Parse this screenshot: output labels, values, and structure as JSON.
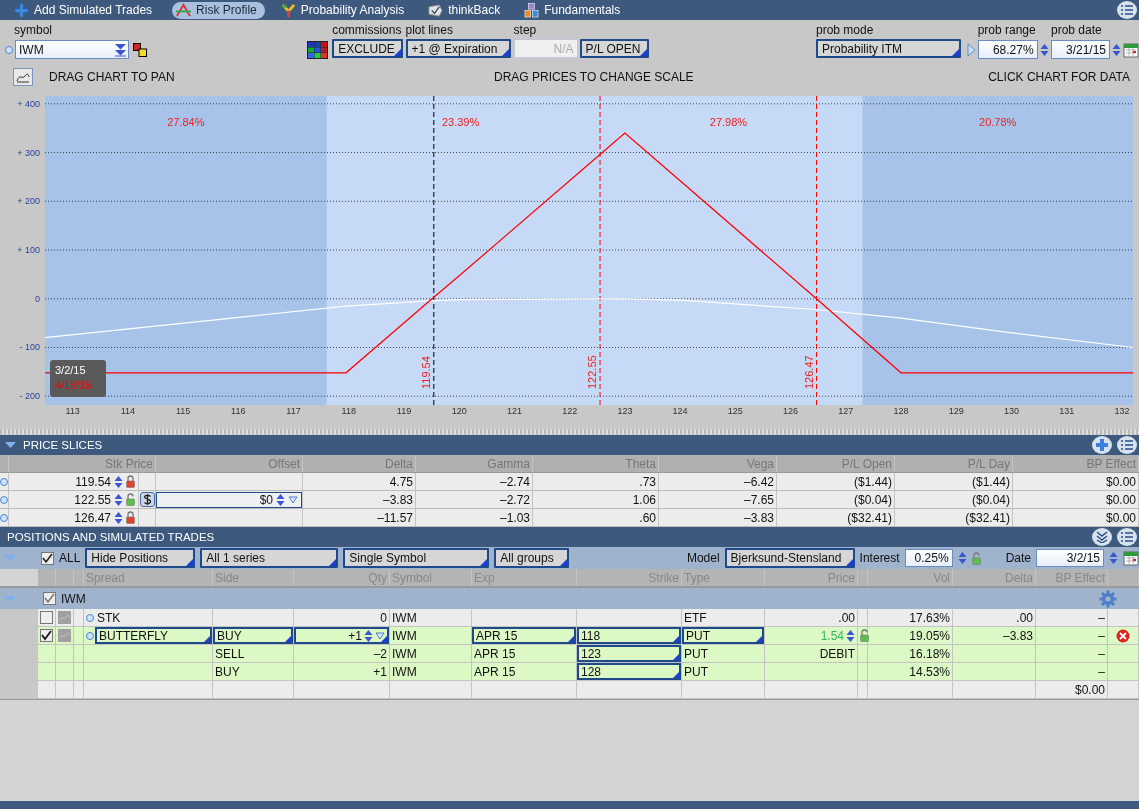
{
  "tabs": [
    {
      "label": "Add Simulated Trades",
      "selected": false
    },
    {
      "label": "Risk Profile",
      "selected": true
    },
    {
      "label": "Probability Analysis",
      "selected": false
    },
    {
      "label": "thinkBack",
      "selected": false
    },
    {
      "label": "Fundamentals",
      "selected": false
    }
  ],
  "controls": {
    "symbol": {
      "label": "symbol",
      "value": "IWM"
    },
    "commissions": {
      "label": "commissions",
      "value": "EXCLUDE"
    },
    "plot_lines": {
      "label": "plot lines",
      "value": "+1 @ Expiration"
    },
    "step": {
      "label": "step",
      "placeholder": "N/A",
      "disabled": true
    },
    "pl_mode": {
      "value": "P/L OPEN"
    },
    "prob_mode": {
      "label": "prob mode",
      "value": "Probability ITM"
    },
    "prob_range": {
      "label": "prob range",
      "value": "68.27%"
    },
    "prob_date": {
      "label": "prob date",
      "value": "3/21/15"
    }
  },
  "chart_hints": [
    "DRAG CHART TO PAN",
    "DRAG PRICES TO CHANGE SCALE",
    "CLICK CHART FOR DATA"
  ],
  "chart_data": {
    "type": "line",
    "x": [
      112.5,
      117.95,
      119.54,
      120,
      122.55,
      123,
      124,
      126.47,
      128,
      130,
      132.2
    ],
    "series": [
      {
        "name": "3/2/15",
        "color": "#ffffff",
        "values": [
          -80,
          -15,
          -4,
          -2,
          0,
          0,
          -3,
          -22,
          -40,
          -70,
          -100
        ]
      },
      {
        "name": "4/18/15",
        "color": "#ff0000",
        "values": [
          -152,
          -152,
          3,
          47,
          296,
          340,
          242,
          0,
          -152,
          -152,
          -152
        ]
      }
    ],
    "xlim": [
      112.5,
      132.2
    ],
    "ylim": [
      -218,
      416
    ],
    "xticks": [
      113,
      114,
      115,
      116,
      117,
      118,
      119,
      120,
      121,
      122,
      123,
      124,
      125,
      126,
      127,
      128,
      129,
      130,
      131,
      132
    ],
    "yticks": [
      {
        "value": 400,
        "label": "+ 400"
      },
      {
        "value": 300,
        "label": "+ 300"
      },
      {
        "value": 200,
        "label": "+ 200"
      },
      {
        "value": 100,
        "label": "+ 100"
      },
      {
        "value": 0,
        "label": "0"
      },
      {
        "value": -100,
        "label": "- 100"
      },
      {
        "value": -200,
        "label": "- 200"
      }
    ],
    "grid": true,
    "bands": [
      {
        "axis": "x",
        "from": 117.6,
        "to": 127.3
      }
    ],
    "ref_lines": [
      {
        "axis": "x",
        "value": 119.54,
        "label": "119.54",
        "color": "#000000"
      },
      {
        "axis": "x",
        "value": 122.55,
        "label": "122.55",
        "color": "#ff0000"
      },
      {
        "axis": "x",
        "value": 126.47,
        "label": "126.47",
        "color": "#ff0000"
      }
    ],
    "annotations": [
      "27.84%",
      "23.39%",
      "27.98%",
      "20.78%"
    ]
  },
  "price_slices": {
    "title": "PRICE SLICES",
    "columns": [
      "Stk Price",
      "Offset",
      "Delta",
      "Gamma",
      "Theta",
      "Vega",
      "P/L Open",
      "P/L Day",
      "BP Effect"
    ],
    "rows": [
      {
        "locked": true,
        "cells": [
          "119.54",
          "",
          "4.75",
          "–2.74",
          ".73",
          "–6.42",
          "($1.44)",
          "($1.44)",
          "$0.00"
        ]
      },
      {
        "locked": false,
        "cells": [
          "122.55",
          "$0",
          "–3.83",
          "–2.72",
          "1.06",
          "–7.65",
          "($0.04)",
          "($0.04)",
          "$0.00"
        ]
      },
      {
        "locked": true,
        "cells": [
          "126.47",
          "",
          "–11.57",
          "–1.03",
          ".60",
          "–3.83",
          "($32.41)",
          "($32.41)",
          "$0.00"
        ]
      }
    ]
  },
  "positions": {
    "title": "POSITIONS AND SIMULATED TRADES",
    "filter": {
      "all_checked": true,
      "all_label": "ALL",
      "show": "Hide Positions",
      "series": "All 1 series",
      "symbol_mode": "Single Symbol",
      "groups": "All groups",
      "model_label": "Model",
      "model": "Bjerksund-Stensland",
      "interest_label": "Interest",
      "interest": "0.25%",
      "date_label": "Date",
      "date": "3/2/15"
    },
    "columns": [
      "Spread",
      "Side",
      "Qty",
      "Symbol",
      "Exp",
      "Strike",
      "Type",
      "Price",
      "Vol",
      "Delta",
      "BP Effect"
    ],
    "group": {
      "label": "IWM",
      "checked": true
    },
    "rows": [
      {
        "kind": "stock",
        "editable": false,
        "checked": false,
        "spread": "STK",
        "qty": "0",
        "symbol": "IWM",
        "type": "ETF",
        "price": ".00",
        "vol": "17.63%",
        "delta": ".00",
        "bp_effect": "–"
      },
      {
        "kind": "option",
        "editable": true,
        "checked": true,
        "spread": "BUTTERFLY",
        "side": "BUY",
        "qty": "+1",
        "symbol": "IWM",
        "exp": "APR 15",
        "strike": "118",
        "type": "PUT",
        "price": "1.54",
        "vol": "19.05%",
        "delta": "–3.83",
        "bp_effect": "–"
      },
      {
        "kind": "option",
        "editable": false,
        "side": "SELL",
        "qty": "–2",
        "symbol": "IWM",
        "exp": "APR 15",
        "strike": "123",
        "type": "PUT",
        "price": "DEBIT",
        "vol": "16.18%",
        "bp_effect": "–"
      },
      {
        "kind": "option",
        "editable": false,
        "side": "BUY",
        "qty": "+1",
        "symbol": "IWM",
        "exp": "APR 15",
        "strike": "128",
        "type": "PUT",
        "vol": "14.53%",
        "bp_effect": "–"
      }
    ],
    "total": "$0.00"
  }
}
